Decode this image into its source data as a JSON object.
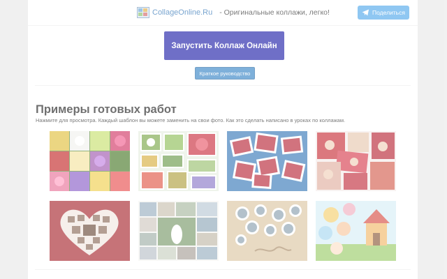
{
  "header": {
    "site_name": "CollageOnline.Ru",
    "tagline": "- Оригинальные коллажи, легко!",
    "share_label": "Поделиться"
  },
  "main": {
    "cta_label": "Запустить Коллаж Онлайн",
    "guide_label": "Краткое руководство"
  },
  "examples": {
    "title": "Примеры готовых работ",
    "description": "Нажмите для просмотра. Каждый шаблон вы можете заменить на свои фото. Как это сделать написано в уроках по коллажам."
  },
  "gallery": {
    "thumbnails": [
      {
        "name": "flower-grid-collage"
      },
      {
        "name": "framed-flowers-collage"
      },
      {
        "name": "christmas-scattered-collage"
      },
      {
        "name": "christmas-family-collage"
      },
      {
        "name": "heart-collage"
      },
      {
        "name": "wedding-grid-collage"
      },
      {
        "name": "sand-hearts-collage"
      },
      {
        "name": "kids-balloons-collage"
      }
    ]
  },
  "colors": {
    "cta_background": "#2222aa",
    "guide_background": "#3a86c6",
    "share_background": "#54a9eb",
    "brand_link": "#2f73b5"
  }
}
